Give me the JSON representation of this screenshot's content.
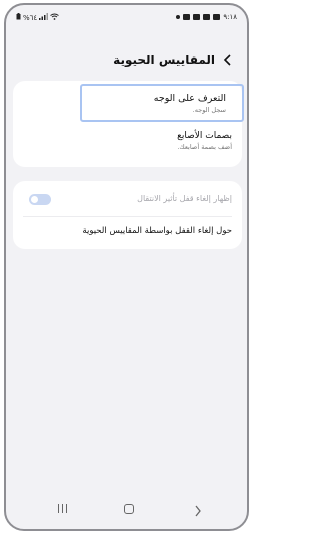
{
  "status_bar": {
    "battery": "%٦٤",
    "time": "٩:١٨"
  },
  "header": {
    "title": "المقاييس الحيوية",
    "back_icon": "chevron-right-icon"
  },
  "biometrics": {
    "face": {
      "title": "التعرف على الوجه",
      "subtitle": "سجل الوجه."
    },
    "fingerprint": {
      "title": "بصمات الأصابع",
      "subtitle": "أضف بصمة أصابعك."
    }
  },
  "settings": {
    "unlock_transition": {
      "label": "إظهار إلغاء قفل تأثير الانتقال",
      "enabled": false
    },
    "about": {
      "label": "حول إلغاء القفل بواسطة المقاييس الحيوية"
    }
  },
  "colors": {
    "accent": "#a9c4f2",
    "toggle_off": "#c9d7f2",
    "background": "#f2f2f5"
  }
}
